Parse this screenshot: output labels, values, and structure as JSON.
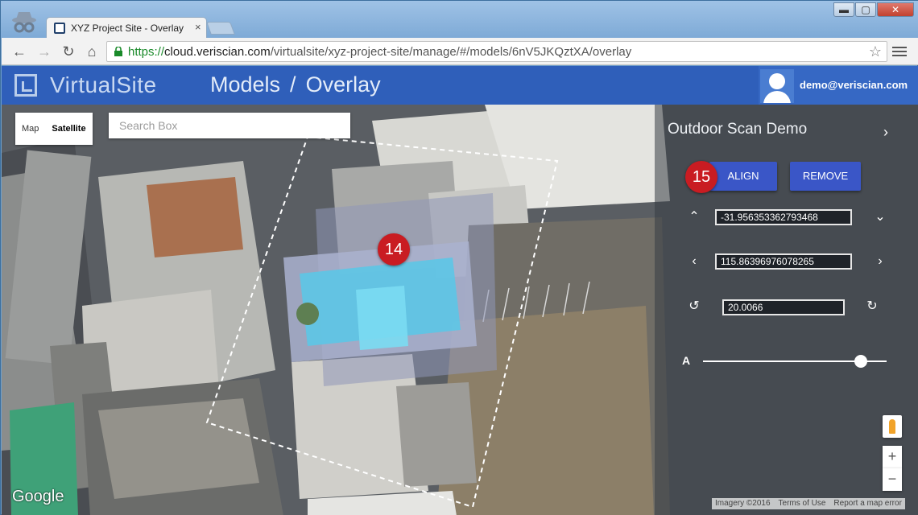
{
  "browser": {
    "tab_title": "XYZ Project Site - Overlay",
    "tab_close": "×",
    "url_scheme": "https://",
    "url_host": "cloud.veriscian.com",
    "url_path": "/virtualsite/xyz-project-site/manage/#/models/6nV5JKQztXA/overlay",
    "win_minimize": "▬",
    "win_maximize": "▢",
    "win_close": "✕"
  },
  "app": {
    "logo": "VirtualSite",
    "breadcrumb_1": "Models",
    "breadcrumb_sep": "/",
    "breadcrumb_2": "Overlay",
    "user_email": "demo@veriscian.com"
  },
  "map": {
    "map_btn": "Map",
    "satellite_btn": "Satellite",
    "search_placeholder": "Search Box",
    "google": "Google",
    "attribution": [
      "Imagery ©2016",
      "Terms of Use",
      "Report a map error"
    ],
    "zoom_in": "+",
    "zoom_out": "−"
  },
  "badges": {
    "model": "14",
    "align": "15"
  },
  "panel": {
    "title": "Outdoor Scan Demo",
    "align_btn": "ALIGN",
    "remove_btn": "REMOVE",
    "lat": "-31.956353362793468",
    "lng": "115.86396976078265",
    "rotation": "20.0066",
    "alpha_label": "A",
    "alpha_value": 0.86
  }
}
